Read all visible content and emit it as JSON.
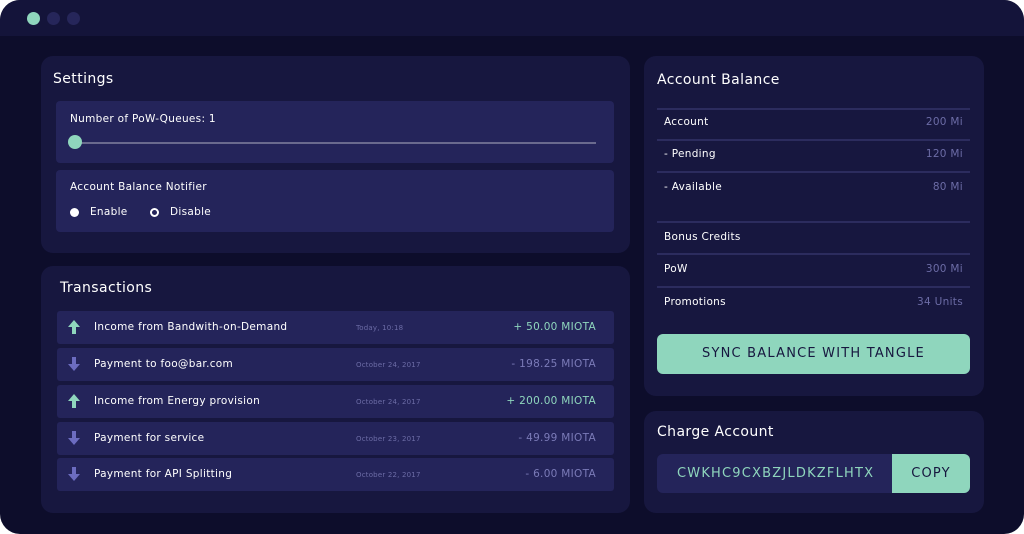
{
  "settings": {
    "title": "Settings",
    "pow_queues_label": "Number of PoW-Queues: 1",
    "pow_queues_value": 1,
    "notifier_label": "Account Balance Notifier",
    "enable_label": "Enable",
    "disable_label": "Disable",
    "selected": "Enable"
  },
  "transactions": {
    "title": "Transactions",
    "items": [
      {
        "direction": "in",
        "description": "Income from Bandwith-on-Demand",
        "date": "Today, 10:18",
        "amount": "+ 50.00 MIOTA"
      },
      {
        "direction": "out",
        "description": "Payment to foo@bar.com",
        "date": "October 24, 2017",
        "amount": "- 198.25 MIOTA"
      },
      {
        "direction": "in",
        "description": "Income from Energy provision",
        "date": "October 24, 2017",
        "amount": "+ 200.00 MIOTA"
      },
      {
        "direction": "out",
        "description": "Payment for service",
        "date": "October 23, 2017",
        "amount": "- 49.99 MIOTA"
      },
      {
        "direction": "out",
        "description": "Payment for API Splitting",
        "date": "October 22, 2017",
        "amount": "- 6.00 MIOTA"
      }
    ]
  },
  "balance": {
    "title": "Account Balance",
    "account_label": "Account",
    "account_value": "200 Mi",
    "pending_label": "- Pending",
    "pending_value": "120 Mi",
    "available_label": "-  Available",
    "available_value": "80 Mi",
    "bonus_label": "Bonus Credits",
    "pow_label": "PoW",
    "pow_value": "300 Mi",
    "promotions_label": "Promotions",
    "promotions_value": "34 Units",
    "sync_label": "SYNC BALANCE WITH TANGLE"
  },
  "charge": {
    "title": "Charge Account",
    "address": "CWKHC9CXBZJLDKZFLHTX",
    "copy_label": "COPY"
  },
  "colors": {
    "accent": "#8fd6bd",
    "background": "#0d0d2b",
    "panel": "#17173f",
    "card": "#24245a",
    "muted_text": "#6c6ca6"
  },
  "icons": {
    "income": "arrow-up-icon",
    "payment": "arrow-down-icon"
  }
}
